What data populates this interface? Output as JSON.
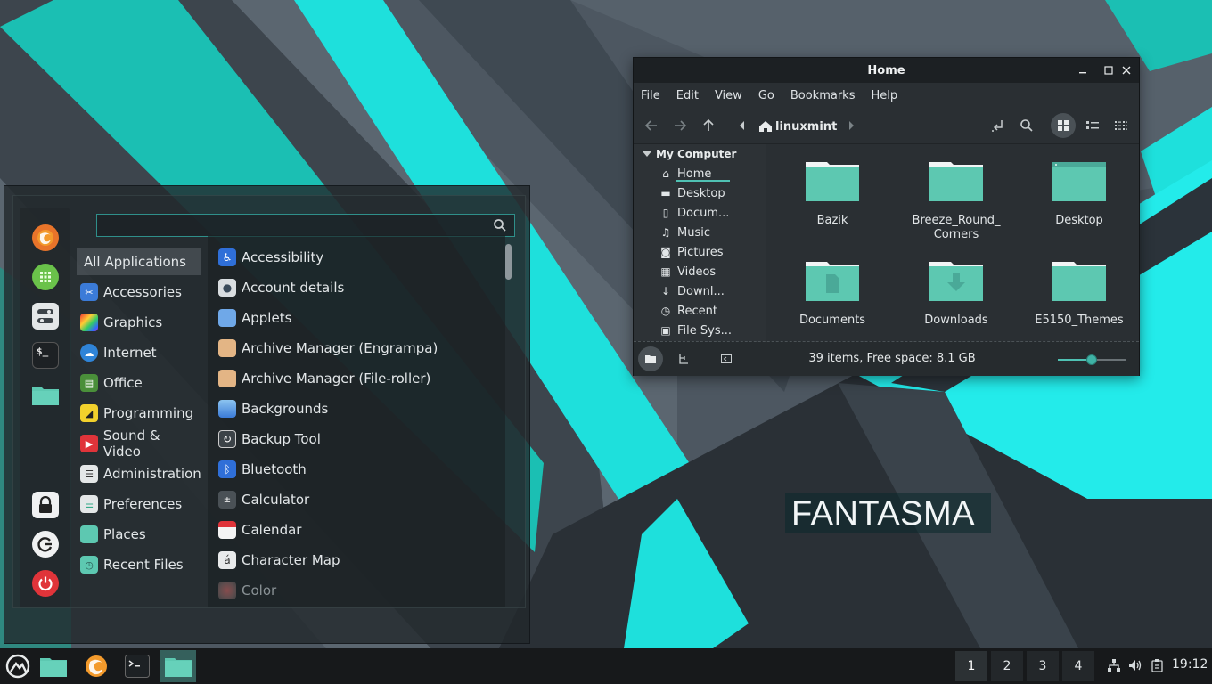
{
  "desktop": {
    "watermark": "FANTASMA"
  },
  "colors": {
    "accent": "#4fc1b3",
    "cyan": "#1de9e4",
    "folder": "#5dc8b1",
    "panel": "#17191b"
  },
  "menu": {
    "search": {
      "value": "",
      "placeholder": ""
    },
    "favorites": [
      {
        "name": "firefox-icon"
      },
      {
        "name": "calculator-grid-icon"
      },
      {
        "name": "settings-toggle-icon"
      },
      {
        "name": "terminal-icon",
        "label": "$_"
      },
      {
        "name": "folder-icon"
      },
      {
        "name": "lock-screen-icon"
      },
      {
        "name": "logout-icon"
      },
      {
        "name": "power-icon"
      }
    ],
    "categories": [
      {
        "label": "All Applications",
        "icon": ""
      },
      {
        "label": "Accessories",
        "icon": "scissors-icon"
      },
      {
        "label": "Graphics",
        "icon": "palette-icon"
      },
      {
        "label": "Internet",
        "icon": "cloud-icon"
      },
      {
        "label": "Office",
        "icon": "office-icon"
      },
      {
        "label": "Programming",
        "icon": "ruler-icon"
      },
      {
        "label": "Sound & Video",
        "icon": "play-icon"
      },
      {
        "label": "Administration",
        "icon": "admin-toggle-icon"
      },
      {
        "label": "Preferences",
        "icon": "preferences-toggle-icon"
      },
      {
        "label": "Places",
        "icon": "folder-icon"
      },
      {
        "label": "Recent Files",
        "icon": "recent-folder-icon"
      }
    ],
    "apps": [
      {
        "label": "Accessibility",
        "icon": "accessibility-icon"
      },
      {
        "label": "Account details",
        "icon": "user-icon"
      },
      {
        "label": "Applets",
        "icon": "applets-icon"
      },
      {
        "label": "Archive Manager (Engrampa)",
        "icon": "archive-icon"
      },
      {
        "label": "Archive Manager (File-roller)",
        "icon": "archive-icon"
      },
      {
        "label": "Backgrounds",
        "icon": "backgrounds-icon"
      },
      {
        "label": "Backup Tool",
        "icon": "backup-icon"
      },
      {
        "label": "Bluetooth",
        "icon": "bluetooth-icon"
      },
      {
        "label": "Calculator",
        "icon": "calculator-icon"
      },
      {
        "label": "Calendar",
        "icon": "calendar-icon"
      },
      {
        "label": "Character Map",
        "icon": "character-map-icon",
        "glyph": "á"
      },
      {
        "label": "Color",
        "icon": "color-icon"
      }
    ]
  },
  "filemanager": {
    "title": "Home",
    "menu": [
      "File",
      "Edit",
      "View",
      "Go",
      "Bookmarks",
      "Help"
    ],
    "location": "linuxmint",
    "sidebar": {
      "header": "My Computer",
      "items": [
        {
          "label": "Home",
          "icon": "home-icon"
        },
        {
          "label": "Desktop",
          "icon": "desktop-icon"
        },
        {
          "label": "Docum...",
          "icon": "document-icon"
        },
        {
          "label": "Music",
          "icon": "music-icon"
        },
        {
          "label": "Pictures",
          "icon": "camera-icon"
        },
        {
          "label": "Videos",
          "icon": "film-icon"
        },
        {
          "label": "Downl...",
          "icon": "download-icon"
        },
        {
          "label": "Recent",
          "icon": "clock-icon"
        },
        {
          "label": "File Sys...",
          "icon": "filesystem-icon"
        }
      ]
    },
    "files": [
      {
        "name": "Bazik",
        "kind": "folder"
      },
      {
        "name": "Breeze_Round_ Corners",
        "kind": "folder"
      },
      {
        "name": "Desktop",
        "kind": "desktop-folder"
      },
      {
        "name": "Documents",
        "kind": "documents-folder"
      },
      {
        "name": "Downloads",
        "kind": "downloads-folder"
      },
      {
        "name": "E5150_Themes",
        "kind": "folder"
      }
    ],
    "status": "39 items, Free space: 8.1 GB",
    "zoom_level": 0.5
  },
  "taskbar": {
    "workspaces": [
      "1",
      "2",
      "3",
      "4"
    ],
    "current_workspace": "1",
    "clock": "19:12"
  }
}
